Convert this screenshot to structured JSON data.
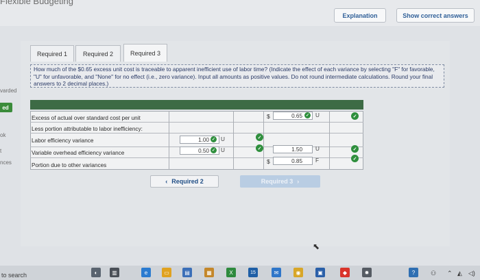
{
  "window": {
    "title_fragment": "Flexible Budgeting"
  },
  "header": {
    "explanation_label": "Explanation",
    "show_correct_label": "Show correct answers"
  },
  "side_fragments": {
    "item1": "varded",
    "badge": "ed",
    "item3": "ok",
    "item4": "t",
    "item5": "nces"
  },
  "tabs": [
    {
      "label": "Required 1"
    },
    {
      "label": "Required 2"
    },
    {
      "label": "Required 3"
    }
  ],
  "question": {
    "text": "How much of the $0.65 excess unit cost is traceable to apparent inefficient use of labor time? (Indicate the effect of each variance by selecting \"F\" for favorable, \"U\" for unfavorable, and \"None\" for no effect (i.e., zero variance). Input all amounts as positive values. Do not round intermediate calculations. Round your final answers to 2 decimal places.)"
  },
  "table": {
    "rows": [
      {
        "label": "Excess of actual over standard cost per unit",
        "dollar": "$",
        "amount": "0.65",
        "effect": "U"
      },
      {
        "label": "Less portion attributable to labor inefficiency:"
      },
      {
        "label": "Labor efficiency variance",
        "amount": "1.00",
        "effect": "U"
      },
      {
        "label": "Variable overhead efficiency variance",
        "amount": "0.50",
        "effect": "U",
        "total": "1.50",
        "total_effect": "U"
      },
      {
        "label": "Portion due to other variances",
        "dollar": "$",
        "total": "0.85",
        "total_effect": "F"
      }
    ]
  },
  "navigation": {
    "prev_label": "Required 2",
    "next_label": "Required 3"
  },
  "taskbar": {
    "search_text": "to search",
    "badge_count": "15"
  },
  "colors": {
    "accent_blue": "#2f5f98",
    "check_green": "#2f8f3d",
    "strip_green": "#3d6b45"
  }
}
